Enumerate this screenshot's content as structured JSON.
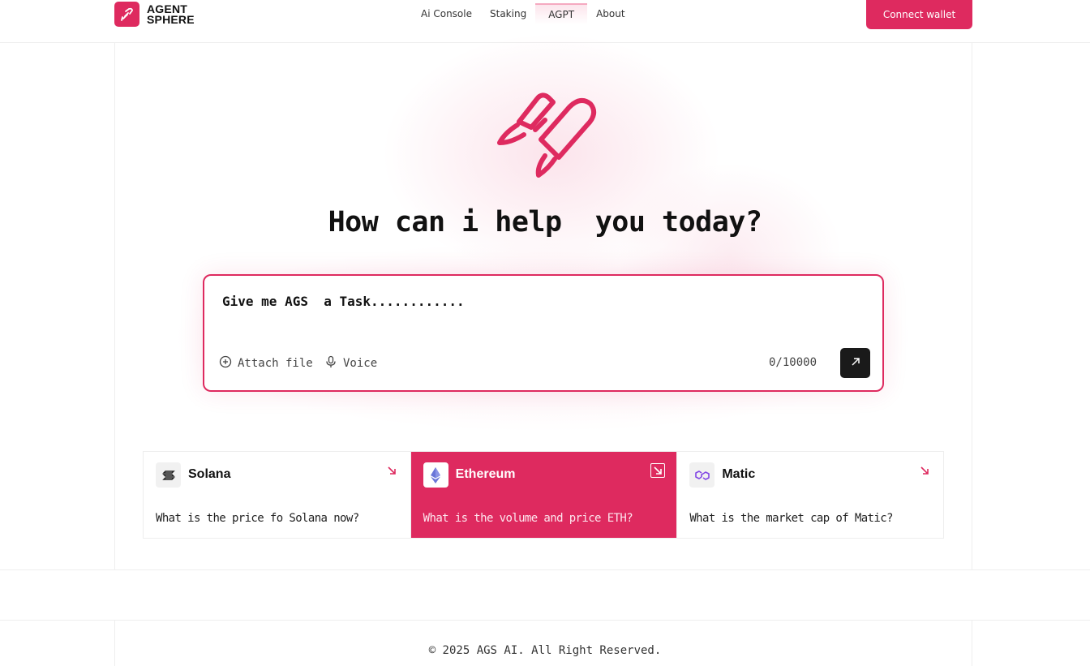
{
  "brand": {
    "line1": "AGENT",
    "line2": "SPHERE",
    "accent": "#de2a5f"
  },
  "nav": {
    "items": [
      {
        "label": "Ai Console"
      },
      {
        "label": "Staking"
      },
      {
        "label": "AGPT"
      },
      {
        "label": "About"
      }
    ],
    "active": "AGPT"
  },
  "header": {
    "connect_label": "Connect wallet"
  },
  "hero": {
    "icon": "rocket-icon",
    "headline": "How can i help  you today?"
  },
  "chat": {
    "placeholder": "Give me AGS  a Task............",
    "attach_label": "Attach file",
    "voice_label": "Voice",
    "counter": "0/10000",
    "send_icon": "arrow-up-right-icon"
  },
  "cards": [
    {
      "title": "Solana",
      "question": "What is the price fo Solana now?",
      "icon": "solana-icon"
    },
    {
      "title": "Ethereum",
      "question": "What is the volume and price ETH?",
      "icon": "ethereum-icon",
      "selected": true
    },
    {
      "title": "Matic",
      "question": "What is the market cap of Matic?",
      "icon": "polygon-icon"
    }
  ],
  "footer": {
    "copyright": "© 2025 AGS AI. All Right Reserved."
  }
}
